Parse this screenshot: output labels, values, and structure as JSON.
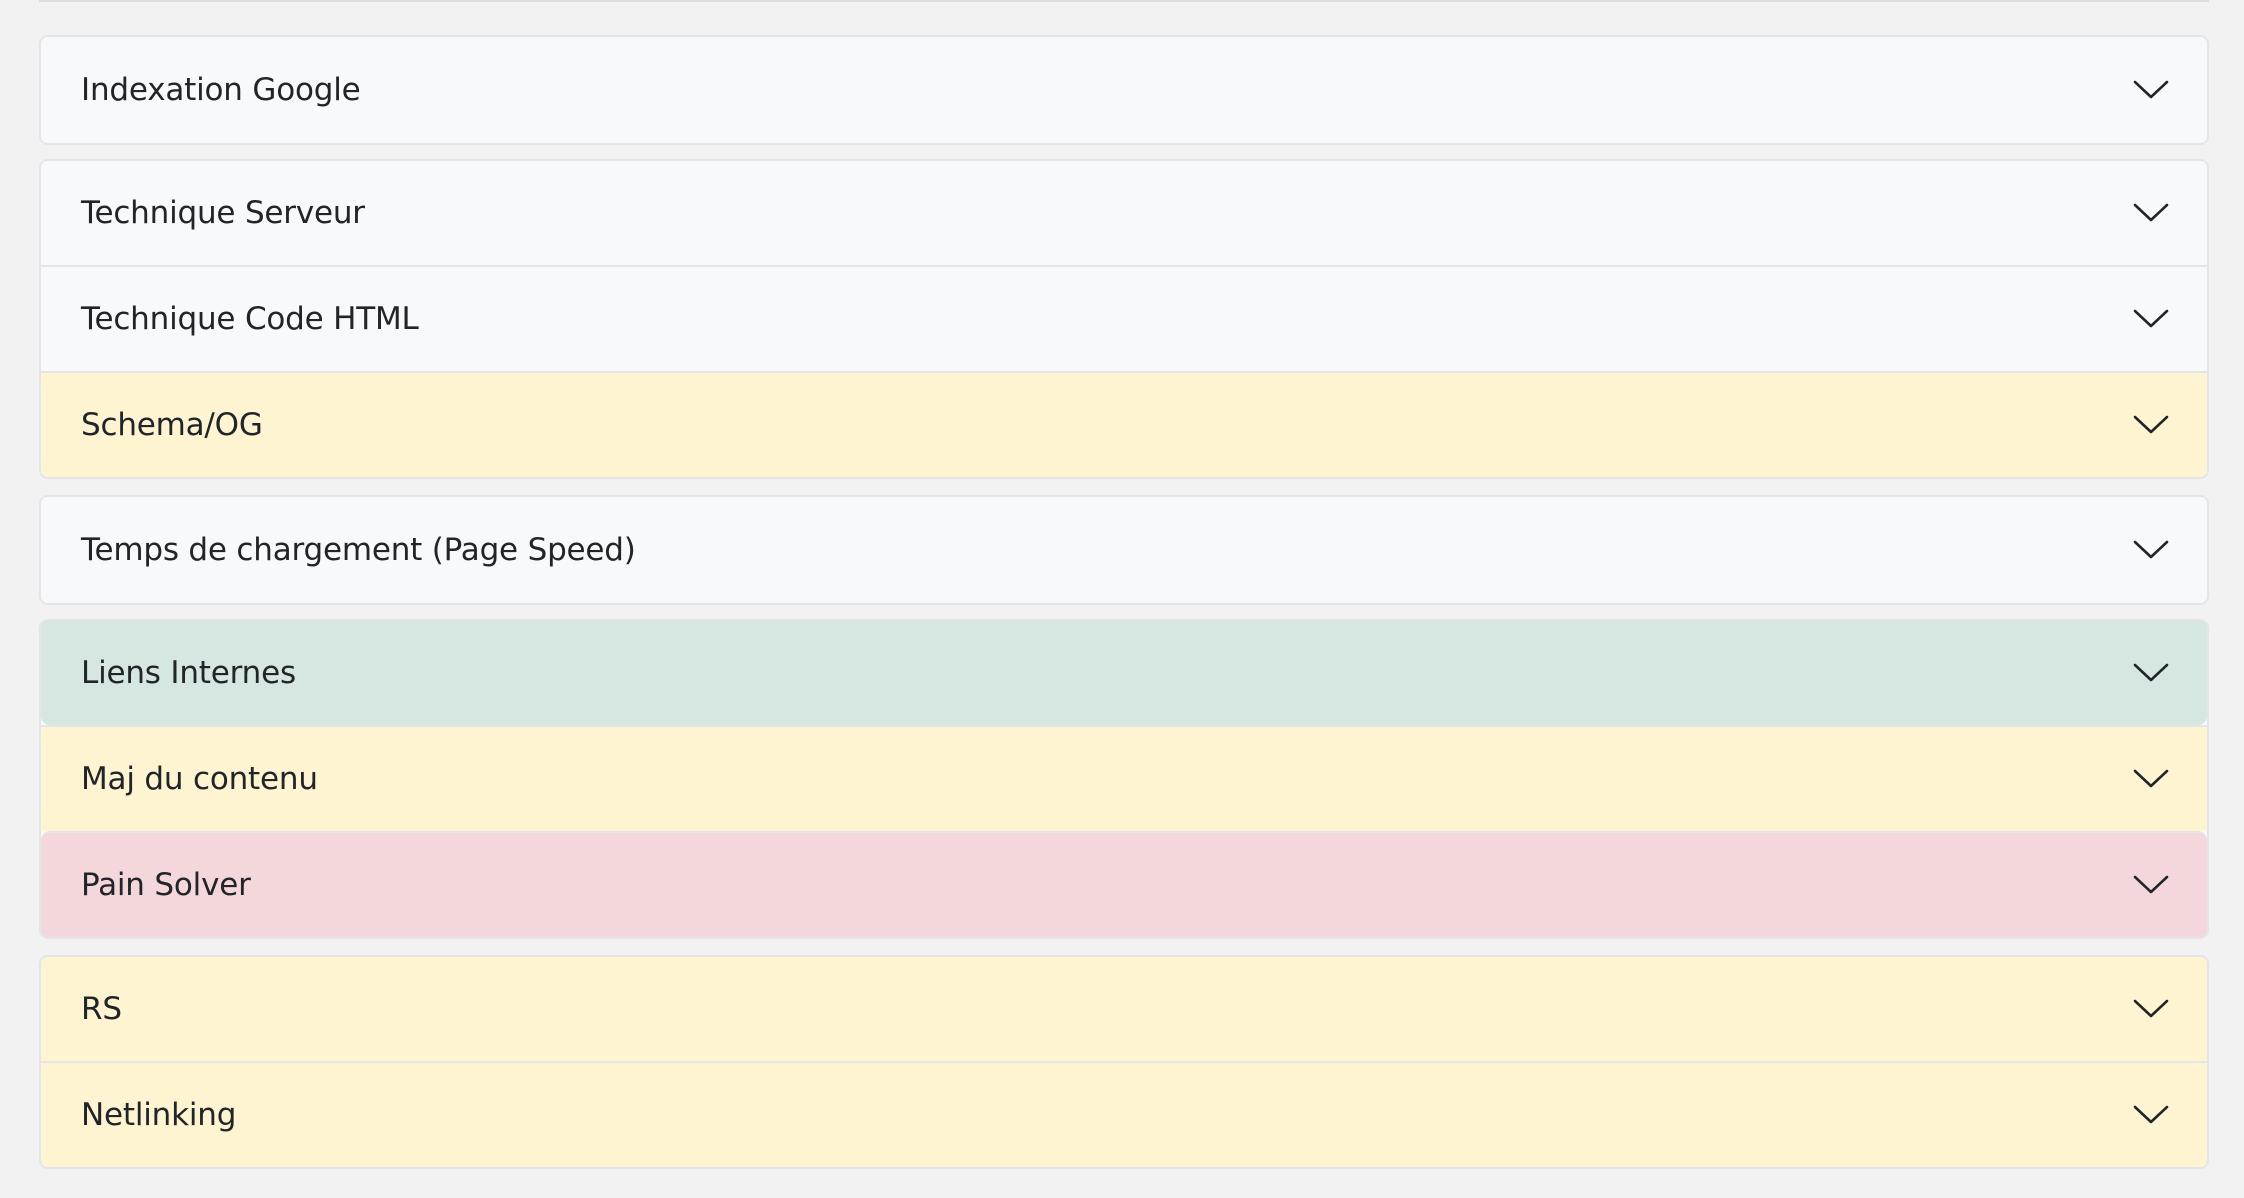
{
  "accordion": {
    "items": [
      {
        "label": "Indexation Google",
        "status": "neutral",
        "icon": "chevron-down-icon"
      },
      {
        "label": "Technique Serveur",
        "status": "neutral",
        "icon": "chevron-down-icon"
      },
      {
        "label": "Technique Code HTML",
        "status": "neutral",
        "icon": "chevron-down-icon"
      },
      {
        "label": "Schema/OG",
        "status": "warning",
        "icon": "chevron-down-icon"
      },
      {
        "label": "Temps de chargement (Page Speed)",
        "status": "neutral",
        "icon": "chevron-down-icon"
      },
      {
        "label": "Liens Internes",
        "status": "success",
        "icon": "chevron-down-icon"
      },
      {
        "label": "Maj du contenu",
        "status": "warning",
        "icon": "chevron-down-icon"
      },
      {
        "label": "Pain Solver",
        "status": "danger",
        "icon": "chevron-down-icon"
      },
      {
        "label": "RS",
        "status": "warning",
        "icon": "chevron-down-icon"
      },
      {
        "label": "Netlinking",
        "status": "warning",
        "icon": "chevron-down-icon"
      }
    ]
  },
  "colors": {
    "page_background": "#f2f2f3",
    "neutral": "#f8f9fb",
    "warning": "#fff4d2",
    "success": "#d5e7e0",
    "danger": "#f4d7db",
    "text": "#212529"
  }
}
